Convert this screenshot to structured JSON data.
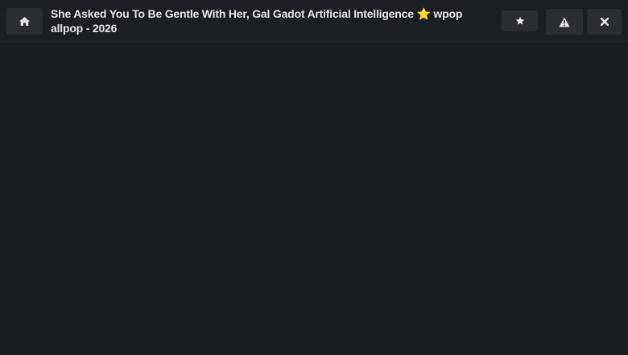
{
  "header": {
    "title": "She Asked You To Be Gentle With Her, Gal Gadot Artificial Intelligence ⭐ wpop allpop - 2026",
    "home_icon": "home-icon",
    "star_icon": "star-icon",
    "warning_icon": "warning-icon",
    "close_icon": "close-icon"
  },
  "colors": {
    "background": "#1a1d21",
    "button": "#2a2e33",
    "text": "#e6e6e6"
  }
}
